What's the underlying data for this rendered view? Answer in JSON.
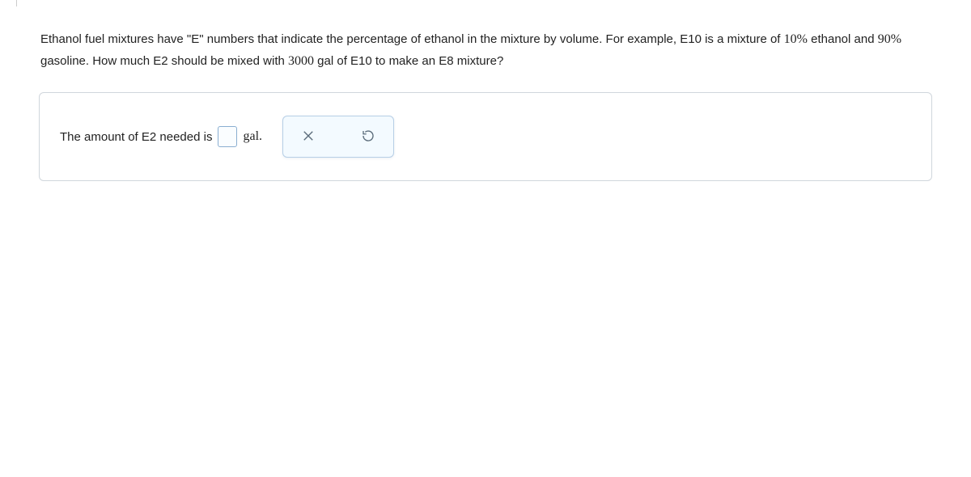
{
  "question": {
    "part1": "Ethanol fuel mixtures have \"E\" numbers that indicate the percentage of ethanol in the mixture by volume. For example, E10 is a mixture of ",
    "pct1": "10%",
    "part2": " ethanol and ",
    "pct2": "90%",
    "part3": " gasoline. How much E2 should be mixed with ",
    "val1": "3000",
    "part4": " gal of E10 to make an E8 mixture?"
  },
  "answer": {
    "prefix": "The amount of E2 needed is",
    "value": "",
    "unit": "gal."
  },
  "toolbar": {
    "clear_label": "Clear",
    "reset_label": "Reset"
  }
}
